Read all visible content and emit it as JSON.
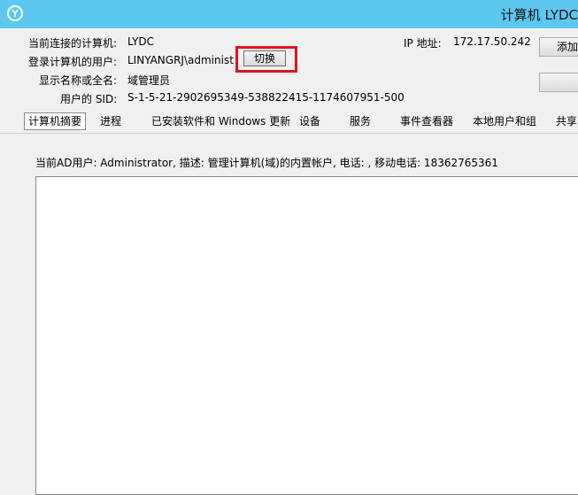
{
  "window": {
    "title": "计算机 LYDC",
    "icon": "app-logo-icon",
    "titlebar_color": "#5cc8f0"
  },
  "info": {
    "computer_label": "当前连接的计算机:",
    "computer_value": "LYDC",
    "user_label": "登录计算机的用户:",
    "user_value": "LINYANGRJ\\administrato",
    "switch_button": "切换",
    "display_label": "显示名称或全名:",
    "display_value": "域管理员",
    "sid_label": "用户的 SID:",
    "sid_value": "S-1-5-21-2902695349-538822415-1174607951-500",
    "ip_label": "IP 地址:",
    "ip_value": "172.17.50.242"
  },
  "side_buttons": {
    "add_label": "添加",
    "second_label": ""
  },
  "tabs": [
    {
      "label": "计算机摘要",
      "active": true
    },
    {
      "label": "进程",
      "active": false
    },
    {
      "label": "已安装软件和 Windows 更新",
      "active": false
    },
    {
      "label": "设备",
      "active": false
    },
    {
      "label": "服务",
      "active": false
    },
    {
      "label": "事件查看器",
      "active": false
    },
    {
      "label": "本地用户和组",
      "active": false
    },
    {
      "label": "共享",
      "active": false
    }
  ],
  "summary": {
    "ad_user_text": "当前AD用户: Administrator, 描述: 管理计算机(域)的内置帐户, 电话: , 移动电话: 18362765361"
  },
  "colors": {
    "highlight_border": "#e0141e"
  }
}
